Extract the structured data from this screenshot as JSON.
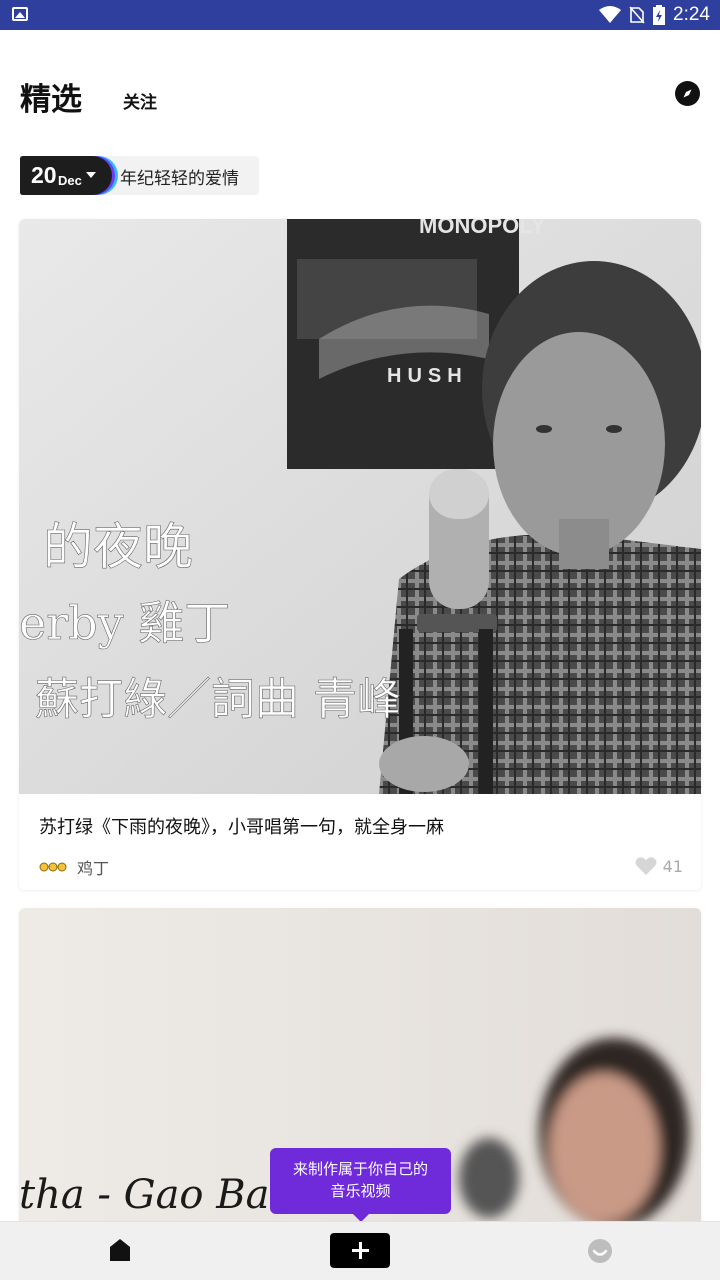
{
  "status_bar": {
    "time": "2:24",
    "icons": [
      "image-icon",
      "wifi-icon",
      "no-sim-icon",
      "battery-charging-icon"
    ]
  },
  "header": {
    "title": "精选",
    "tab_follow": "关注",
    "explore_icon": "compass-icon"
  },
  "date_chip": {
    "day": "20",
    "month": "Dec",
    "topic": "年纪轻轻的爱情"
  },
  "feed": [
    {
      "thumbnail_text": [
        "的夜晚",
        "erby 雞丁",
        "蘇打綠／詞曲  青峰"
      ],
      "poster_text": [
        "MONOPOLY",
        "HUSH"
      ],
      "title": "苏打绿《下雨的夜晚》，小哥唱第一句，就全身一麻",
      "author": "鸡丁",
      "likes": "41"
    },
    {
      "thumbnail_text": "tha - Gao Ba"
    }
  ],
  "tooltip": {
    "line1": "来制作属于你自己的",
    "line2": "音乐视频"
  },
  "bottom_nav": {
    "home_icon": "home-icon",
    "add_icon": "plus-icon",
    "profile_icon": "smiley-icon"
  },
  "colors": {
    "status_bar": "#2f3f9e",
    "accent": "#6f2bd9",
    "badge_bg": "#1d1d1d"
  }
}
